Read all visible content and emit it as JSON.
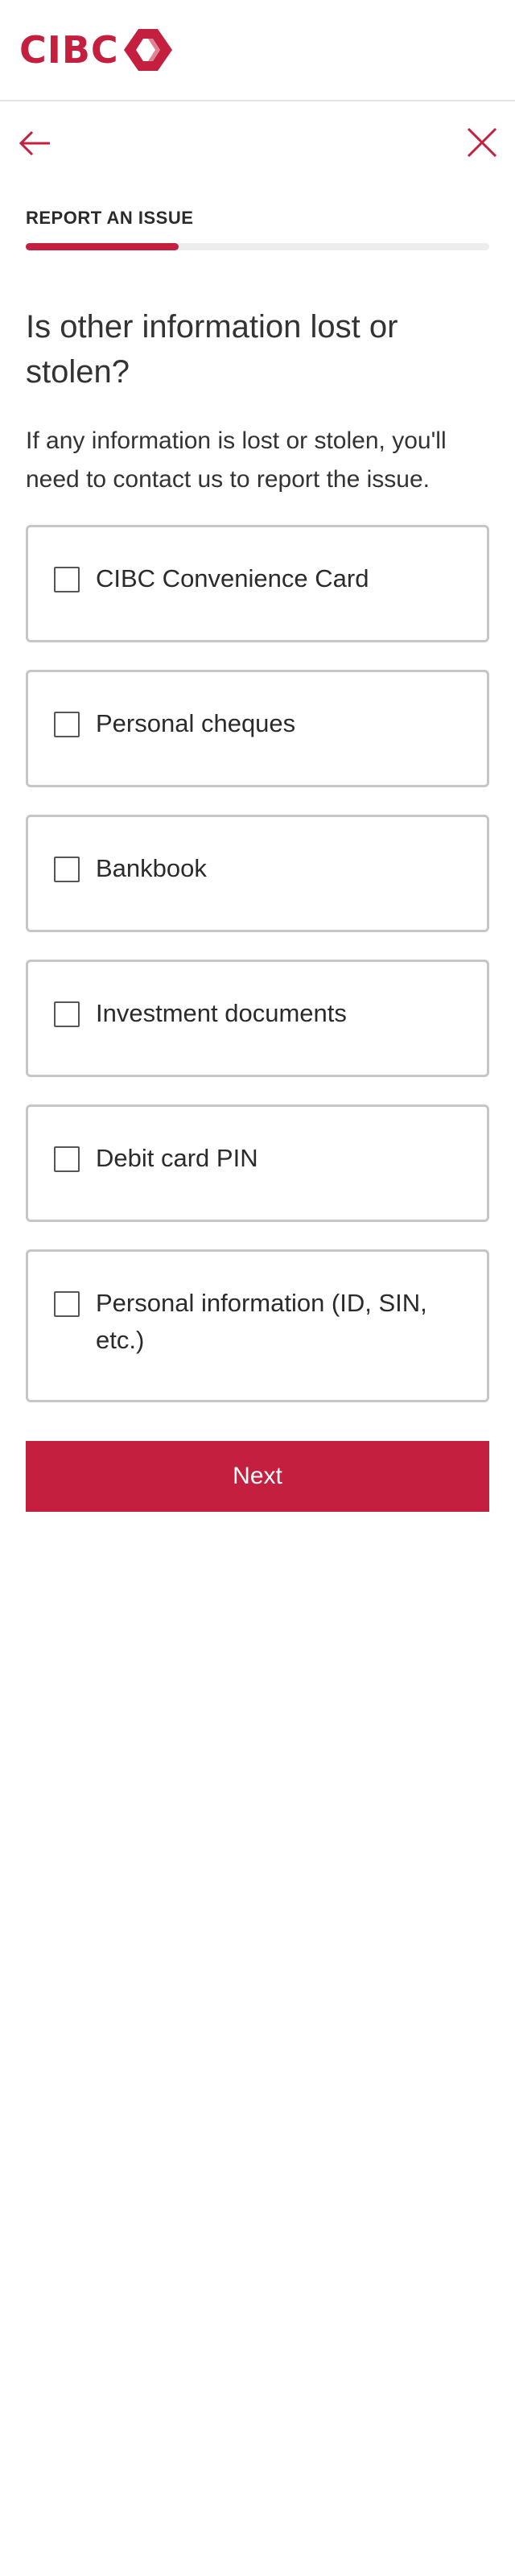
{
  "header": {
    "logo_text": "CIBC",
    "brand_color": "#c41f3e"
  },
  "nav": {
    "back_icon": "arrow-left-icon",
    "close_icon": "close-icon"
  },
  "page": {
    "eyebrow": "REPORT AN ISSUE",
    "progress_fraction": 0.33,
    "question": "Is other information lost or stolen?",
    "description": "If any information is lost or stolen, you'll need to contact us to report the issue."
  },
  "options": [
    {
      "label": "CIBC Convenience Card",
      "checked": false
    },
    {
      "label": "Personal cheques",
      "checked": false
    },
    {
      "label": "Bankbook",
      "checked": false
    },
    {
      "label": "Investment documents",
      "checked": false
    },
    {
      "label": "Debit card PIN",
      "checked": false
    },
    {
      "label": "Personal information (ID, SIN, etc.)",
      "checked": false
    }
  ],
  "actions": {
    "next_label": "Next"
  }
}
